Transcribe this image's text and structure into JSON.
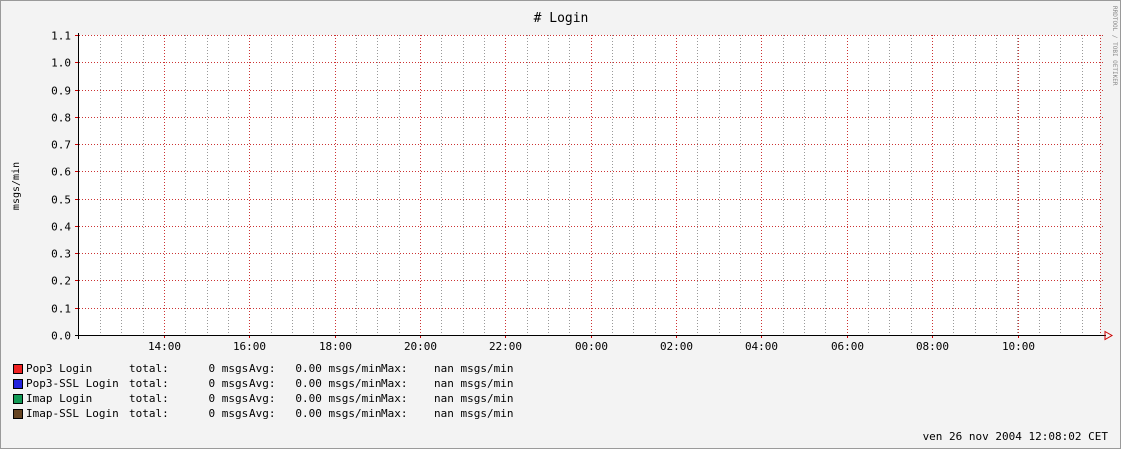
{
  "chart_data": {
    "type": "line",
    "title": "# Login",
    "ylabel": "msgs/min",
    "ylim": [
      0,
      1.1
    ],
    "yticks": [
      "0.0",
      "0.1",
      "0.2",
      "0.3",
      "0.4",
      "0.5",
      "0.6",
      "0.7",
      "0.8",
      "0.9",
      "1.0",
      "1.1"
    ],
    "xticks": [
      "14:00",
      "16:00",
      "18:00",
      "20:00",
      "22:00",
      "00:00",
      "02:00",
      "04:00",
      "06:00",
      "08:00",
      "10:00"
    ],
    "grid": true,
    "credit": "RRDTOOL / TOBI OETIKER",
    "series": [
      {
        "name": "Pop3 Login",
        "color": "#ee2222",
        "total": "total:      0 msgs",
        "avg": "Avg:   0.00 msgs/min",
        "max": "Max:    nan msgs/min"
      },
      {
        "name": "Pop3-SSL Login",
        "color": "#2222dd",
        "total": "total:      0 msgs",
        "avg": "Avg:   0.00 msgs/min",
        "max": "Max:    nan msgs/min"
      },
      {
        "name": "Imap Login",
        "color": "#119955",
        "total": "total:      0 msgs",
        "avg": "Avg:   0.00 msgs/min",
        "max": "Max:    nan msgs/min"
      },
      {
        "name": "Imap-SSL Login",
        "color": "#664422",
        "total": "total:      0 msgs",
        "avg": "Avg:   0.00 msgs/min",
        "max": "Max:    nan msgs/min"
      }
    ]
  },
  "timestamp": "ven 26 nov 2004 12:08:02 CET"
}
